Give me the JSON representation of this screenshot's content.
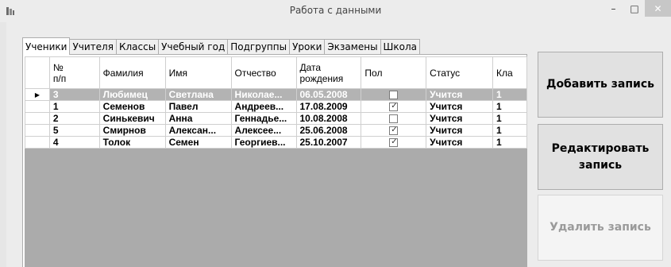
{
  "window": {
    "title": "Работа с данными",
    "minimize_glyph": "–",
    "maximize_glyph": "□",
    "close_glyph": "✕"
  },
  "tabs": [
    "Ученики",
    "Учителя",
    "Классы",
    "Учебный год",
    "Подгруппы",
    "Уроки",
    "Экзамены",
    "Школа"
  ],
  "active_tab": "Ученики",
  "grid": {
    "columns": [
      "№\nп/п",
      "Фамилия",
      "Имя",
      "Отчество",
      "Дата\nрождения",
      "Пол",
      "Статус",
      "Кла"
    ],
    "rows": [
      {
        "selected": true,
        "num": "3",
        "last": "Любимец",
        "first": "Светлана",
        "middle": "Николае...",
        "dob": "06.05.2008",
        "gender_checked": false,
        "status": "Учится",
        "class": "1"
      },
      {
        "selected": false,
        "num": "1",
        "last": "Семенов",
        "first": "Павел",
        "middle": "Андреев...",
        "dob": "17.08.2009",
        "gender_checked": true,
        "status": "Учится",
        "class": "1"
      },
      {
        "selected": false,
        "num": "2",
        "last": "Синькевич",
        "first": "Анна",
        "middle": "Геннадье...",
        "dob": "10.08.2008",
        "gender_checked": false,
        "status": "Учится",
        "class": "1"
      },
      {
        "selected": false,
        "num": "5",
        "last": "Смирнов",
        "first": "Алексан...",
        "middle": "Алексее...",
        "dob": "25.06.2008",
        "gender_checked": true,
        "status": "Учится",
        "class": "1"
      },
      {
        "selected": false,
        "num": "4",
        "last": "Толок",
        "first": "Семен",
        "middle": "Георгиев...",
        "dob": "25.10.2007",
        "gender_checked": true,
        "status": "Учится",
        "class": "1"
      }
    ],
    "row_indicator_glyph": "▶"
  },
  "buttons": {
    "add": "Добавить запись",
    "edit": "Редактировать запись",
    "delete": "Удалить запись"
  },
  "icons": {
    "app": "app-icon",
    "checkbox": "checkbox-icon"
  }
}
